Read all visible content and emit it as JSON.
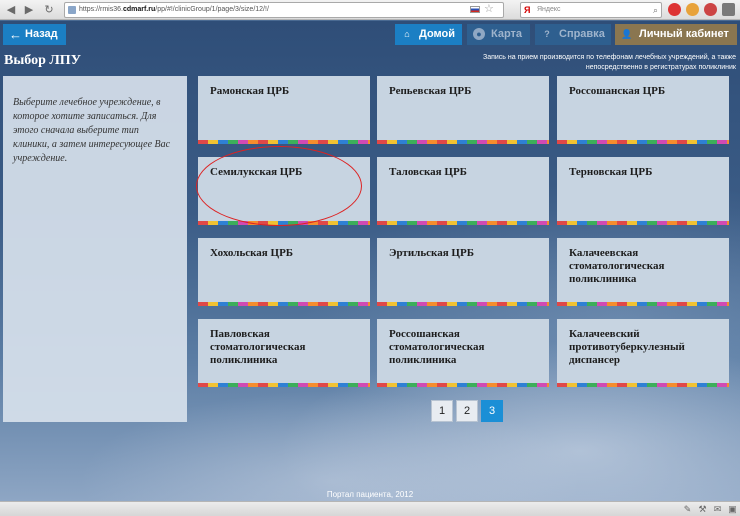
{
  "browser": {
    "url_prefix": "https://rmis36.",
    "url_host": "cdmarf.ru",
    "url_path": "/pp/#!/clinicGroup/1/page/3/size/12/!/",
    "search_placeholder": "Яндекс",
    "search_logo": "Я"
  },
  "nav": {
    "back_label": "Назад",
    "home_label": "Домой",
    "map_label": "Карта",
    "help_label": "Справка",
    "cabinet_label": "Личный кабинет"
  },
  "page_title": "Выбор ЛПУ",
  "notice": "Запись на прием производится по телефонам лечебных учреждений, а также непосредственно в регистратурах поликлиник",
  "info_text": "Выберите лечебное учреждение, в которое хотите записаться. Для этого сначала выберите тип клиники, а затем интересующее Вас учреждение.",
  "clinics": [
    "Рамонская ЦРБ",
    "Репьевская ЦРБ",
    "Россошанская ЦРБ",
    "Семилукская ЦРБ",
    "Таловская ЦРБ",
    "Терновская ЦРБ",
    "Хохольская ЦРБ",
    "Эртильская ЦРБ",
    "Калачеевская стоматологическая поликлиника",
    "Павловская стоматологическая поликлиника",
    "Россошанская стоматологическая поликлиника",
    "Калачеевский противотуберкулезный диспансер"
  ],
  "highlighted_clinic": "Семилукская ЦРБ",
  "pagination": {
    "pages": [
      "1",
      "2",
      "3"
    ],
    "current": "3"
  },
  "footer": "Портал пациента, 2012",
  "colors": {
    "primary_button": "#1b7fc4",
    "disabled_button": "#2e5f8f",
    "cabinet_button": "#8a7650",
    "tile_bg": "#c7d4e1",
    "active_page": "#1b8fd6",
    "highlight_oval": "#dd2222"
  },
  "icons": {
    "back": "arrow-left-icon",
    "home": "home-icon",
    "map": "map-pin-icon",
    "help": "question-icon",
    "cabinet": "user-icon"
  }
}
